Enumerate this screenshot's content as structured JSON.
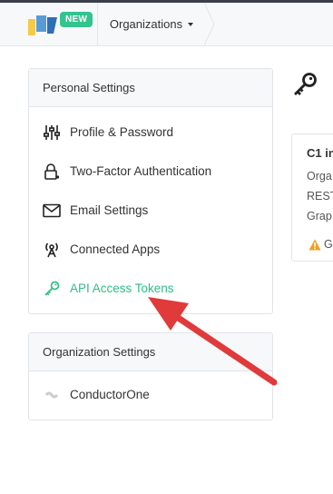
{
  "header": {
    "new_badge": "NEW",
    "organizations_label": "Organizations",
    "accent_color": "#34c38f"
  },
  "personal_settings": {
    "title": "Personal Settings",
    "items": [
      {
        "label": "Profile & Password",
        "icon": "sliders-icon"
      },
      {
        "label": "Two-Factor Authentication",
        "icon": "lock-icon"
      },
      {
        "label": "Email Settings",
        "icon": "envelope-icon"
      },
      {
        "label": "Connected Apps",
        "icon": "broadcast-tower-icon"
      },
      {
        "label": "API Access Tokens",
        "icon": "key-icon",
        "active": true
      }
    ]
  },
  "organization_settings": {
    "title": "Organization Settings",
    "items": [
      {
        "label": "ConductorOne",
        "icon": "org-logo-icon"
      }
    ]
  },
  "main_card": {
    "title": "C1 in",
    "lines": [
      "Orga",
      "REST",
      "Grap"
    ],
    "warning_text": "G"
  },
  "annotation": {
    "type": "red-arrow",
    "color": "#e03a3a",
    "target": "API Access Tokens"
  }
}
